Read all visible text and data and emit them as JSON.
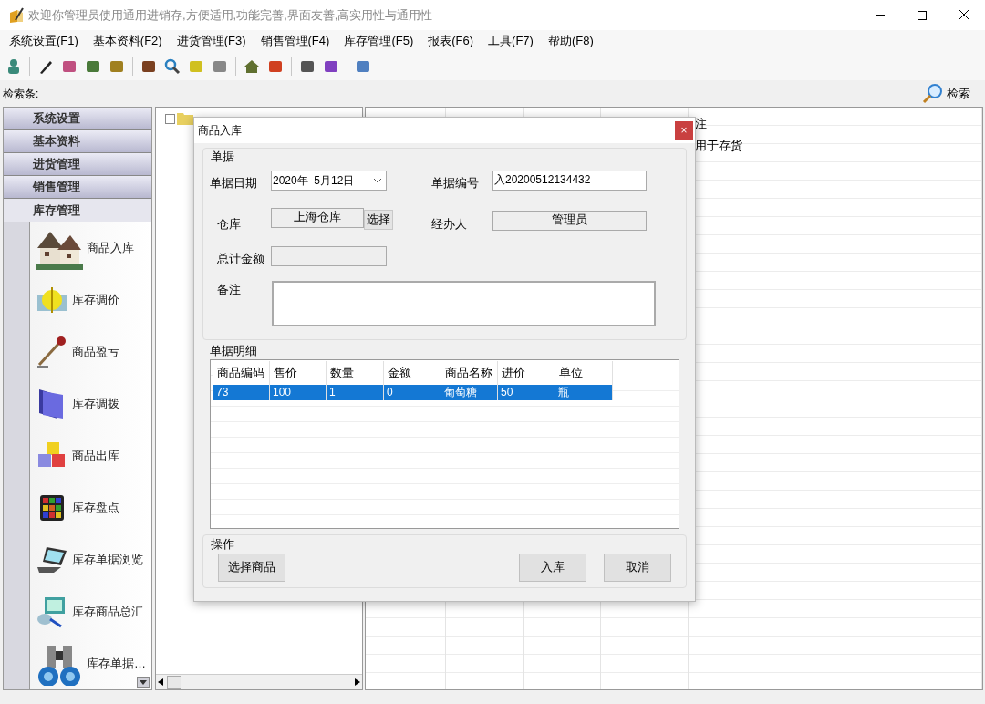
{
  "window": {
    "title": "欢迎你管理员使用通用进销存,方便适用,功能完善,界面友善,高实用性与通用性"
  },
  "menu": [
    "系统设置(F1)",
    "基本资料(F2)",
    "进货管理(F3)",
    "销售管理(F4)",
    "库存管理(F5)",
    "报表(F6)",
    "工具(F7)",
    "帮助(F8)"
  ],
  "search_bar": {
    "label": "检索条:",
    "button": "检索"
  },
  "sidebar": {
    "groups": [
      {
        "label": "系统设置",
        "expanded": false
      },
      {
        "label": "基本资料",
        "expanded": false
      },
      {
        "label": "进货管理",
        "expanded": false
      },
      {
        "label": "销售管理",
        "expanded": false
      },
      {
        "label": "库存管理",
        "expanded": true
      }
    ],
    "items": [
      "商品入库",
      "库存调价",
      "商品盈亏",
      "库存调拨",
      "商品出库",
      "库存盘点",
      "库存单据浏览",
      "库存商品总汇",
      "库存单据…"
    ]
  },
  "background_grid": {
    "column_header": "注",
    "cell": "用于存货"
  },
  "dialog": {
    "title": "商品入库",
    "close": "×",
    "voucher": {
      "label": "单据",
      "date_label": "单据日期",
      "date": "2020年  5月12日",
      "number_label": "单据编号",
      "number": "入20200512134432",
      "warehouse_label": "仓库",
      "warehouse": "上海仓库",
      "choose_button": "选择",
      "handler_label": "经办人",
      "handler": "管理员",
      "total_label": "总计金额",
      "note_label": "备注"
    },
    "details": {
      "label": "单据明细",
      "columns": [
        "商品编码",
        "售价",
        "数量",
        "金额",
        "商品名称",
        "进价",
        "单位"
      ],
      "rows": [
        {
          "cells": [
            "73",
            "100",
            "1",
            "0",
            "葡萄糖",
            "50",
            "瓶"
          ],
          "selected": true
        }
      ]
    },
    "actions": {
      "label": "操作",
      "buttons": [
        "选择商品",
        "入库",
        "取消"
      ]
    }
  }
}
